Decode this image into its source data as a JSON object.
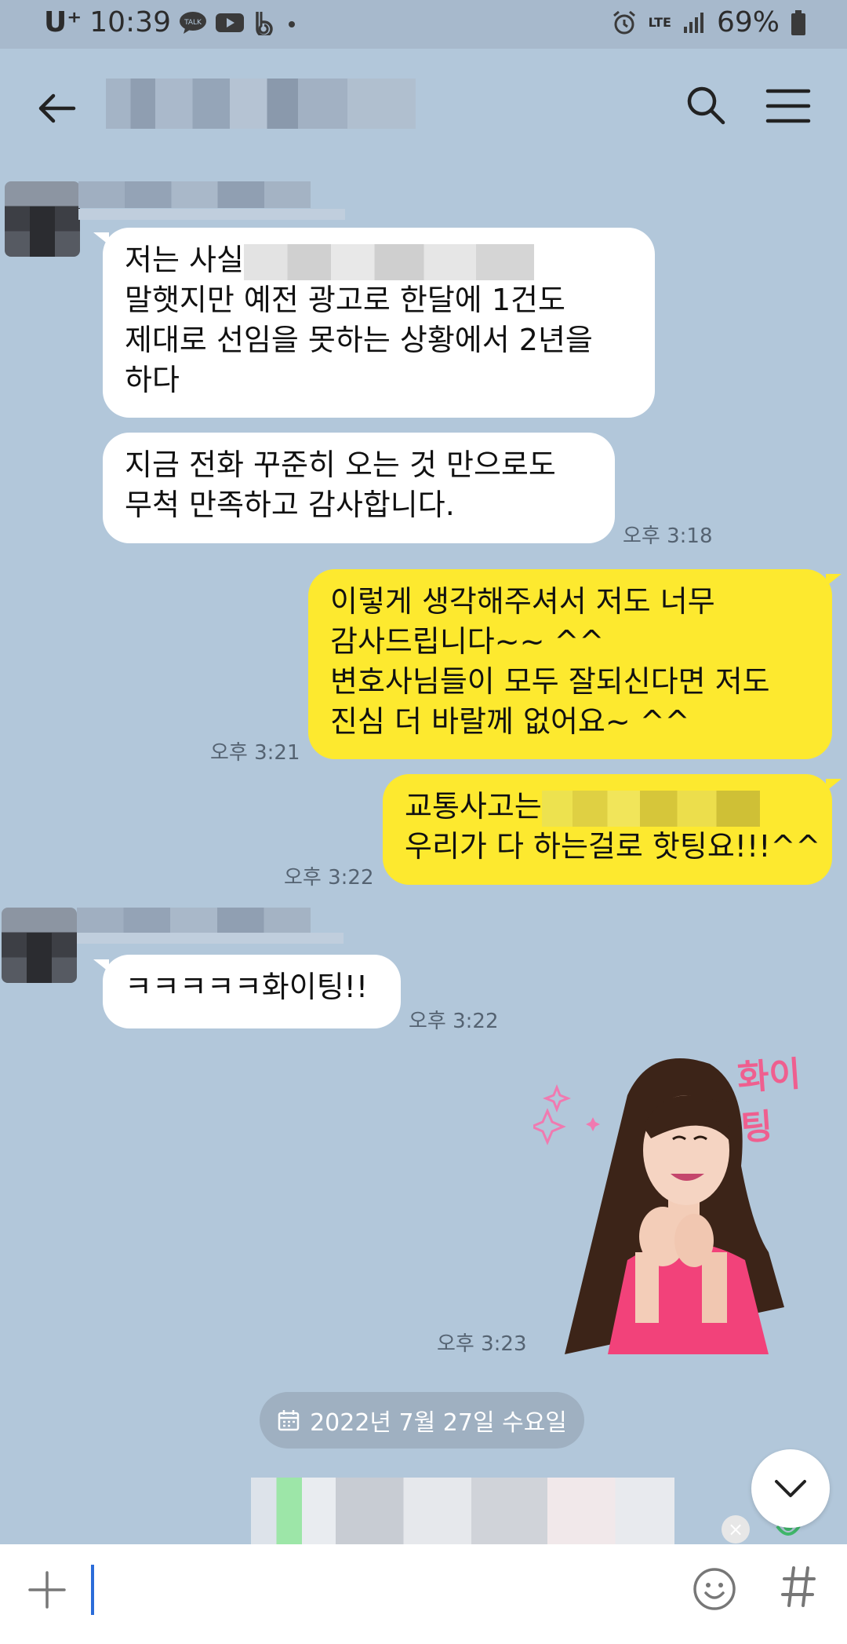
{
  "status_bar": {
    "carrier": "U⁺",
    "time": "10:39",
    "talk_badge": "TALK",
    "network": "LTE",
    "battery": "69%"
  },
  "messages": [
    {
      "lines": [
        "저는 사실",
        "말햇지만 예전 광고로 한달에 1건도",
        "제대로 선임을 못하는 상황에서 2년을",
        "하다"
      ]
    },
    {
      "lines": [
        "지금 전화 꾸준히 오는 것 만으로도",
        "무척 만족하고 감사합니다."
      ],
      "time": "오후 3:18"
    },
    {
      "lines": [
        "이렇게 생각해주셔서 저도 너무",
        "감사드립니다~~ ^^",
        "변호사님들이 모두 잘되신다면 저도",
        "진심 더 바랄께 없어요~ ^^"
      ],
      "time": "오후 3:21"
    },
    {
      "lines": [
        "교통사고는",
        "우리가 다 하는걸로 핫팅요!!!^^"
      ],
      "time": "오후 3:22"
    },
    {
      "lines": [
        "ㅋㅋㅋㅋㅋ화이팅!!"
      ],
      "time": "오후 3:22"
    }
  ],
  "sticker": {
    "text": "화이팅",
    "time": "오후 3:23"
  },
  "date_divider": "2022년 7월 27일 수요일",
  "icons": {
    "back": "arrow-left-icon",
    "search": "search-icon",
    "menu": "hamburger-menu-icon",
    "plus": "plus-icon",
    "emoji": "emoji-icon",
    "hash": "hash-icon",
    "scroll": "chevron-down-icon"
  },
  "colors": {
    "background": "#b2c7da",
    "incoming_bubble": "#ffffff",
    "outgoing_bubble": "#fde92f",
    "sticker_text": "#ef5f8f"
  }
}
